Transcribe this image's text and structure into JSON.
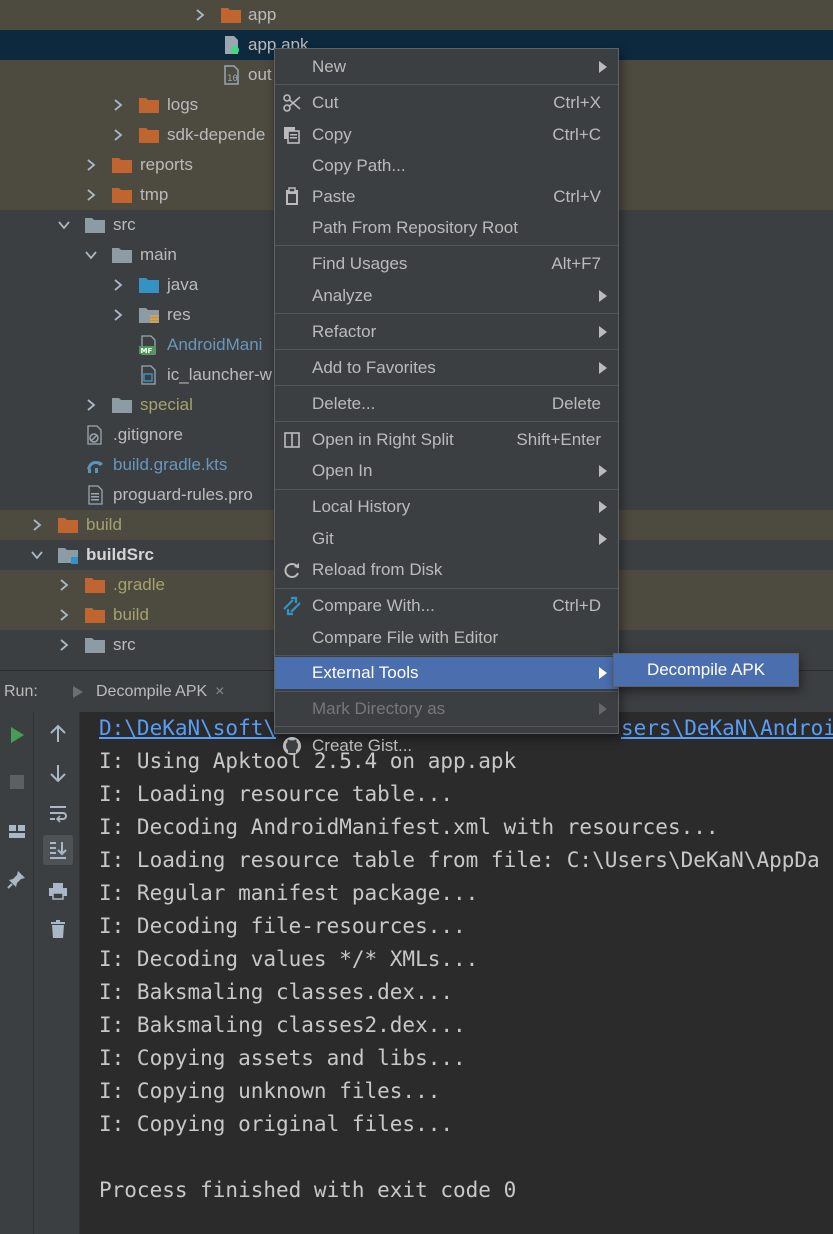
{
  "tree": {
    "rows": [
      {
        "label": "app"
      },
      {
        "label": "app.apk"
      },
      {
        "label": "out"
      },
      {
        "label": "logs"
      },
      {
        "label": "sdk-depende"
      },
      {
        "label": "reports"
      },
      {
        "label": "tmp"
      },
      {
        "label": "src"
      },
      {
        "label": "main"
      },
      {
        "label": "java"
      },
      {
        "label": "res"
      },
      {
        "label": "AndroidMani"
      },
      {
        "label": "ic_launcher-w"
      },
      {
        "label": "special"
      },
      {
        "label": ".gitignore"
      },
      {
        "label": "build.gradle.kts"
      },
      {
        "label": "proguard-rules.pro"
      },
      {
        "label": "build"
      },
      {
        "label": "buildSrc"
      },
      {
        "label": ".gradle"
      },
      {
        "label": "build"
      },
      {
        "label": "src"
      }
    ]
  },
  "context_menu": {
    "items": [
      {
        "label": "New",
        "shortcut": ""
      },
      {
        "label": "Cut",
        "shortcut": "Ctrl+X"
      },
      {
        "label": "Copy",
        "shortcut": "Ctrl+C"
      },
      {
        "label": "Copy Path...",
        "shortcut": ""
      },
      {
        "label": "Paste",
        "shortcut": "Ctrl+V"
      },
      {
        "label": "Path From Repository Root",
        "shortcut": ""
      },
      {
        "label": "Find Usages",
        "shortcut": "Alt+F7"
      },
      {
        "label": "Analyze",
        "shortcut": ""
      },
      {
        "label": "Refactor",
        "shortcut": ""
      },
      {
        "label": "Add to Favorites",
        "shortcut": ""
      },
      {
        "label": "Delete...",
        "shortcut": "Delete"
      },
      {
        "label": "Open in Right Split",
        "shortcut": "Shift+Enter"
      },
      {
        "label": "Open In",
        "shortcut": ""
      },
      {
        "label": "Local History",
        "shortcut": ""
      },
      {
        "label": "Git",
        "shortcut": ""
      },
      {
        "label": "Reload from Disk",
        "shortcut": ""
      },
      {
        "label": "Compare With...",
        "shortcut": "Ctrl+D"
      },
      {
        "label": "Compare File with Editor",
        "shortcut": ""
      },
      {
        "label": "External Tools",
        "shortcut": ""
      },
      {
        "label": "Mark Directory as",
        "shortcut": ""
      },
      {
        "label": "Create Gist...",
        "shortcut": ""
      }
    ],
    "submenu": {
      "label": "Decompile APK"
    }
  },
  "run": {
    "label": "Run:",
    "tab_title": "Decompile APK",
    "close_glyph": "×"
  },
  "console": {
    "lines": [
      "D:\\DeKaN\\soft\\",
      "sers\\DeKaN\\Androi",
      "I: Using Apktool 2.5.4 on app.apk",
      "I: Loading resource table...",
      "I: Decoding AndroidManifest.xml with resources...",
      "I: Loading resource table from file: C:\\Users\\DeKaN\\AppDa",
      "I: Regular manifest package...",
      "I: Decoding file-resources...",
      "I: Decoding values */* XMLs...",
      "I: Baksmaling classes.dex...",
      "I: Baksmaling classes2.dex...",
      "I: Copying assets and libs...",
      "I: Copying unknown files...",
      "I: Copying original files...",
      "Process finished with exit code 0"
    ]
  },
  "colors": {
    "menu_highlight": "#4b6eaf",
    "folder_orange": "#c0652f",
    "folder_grey": "#8d9ba5",
    "folder_blue": "#3592c4",
    "selection": "#0d293e",
    "excluded_bg": "#4d4a3f",
    "console_bg": "#2b2b2b"
  }
}
